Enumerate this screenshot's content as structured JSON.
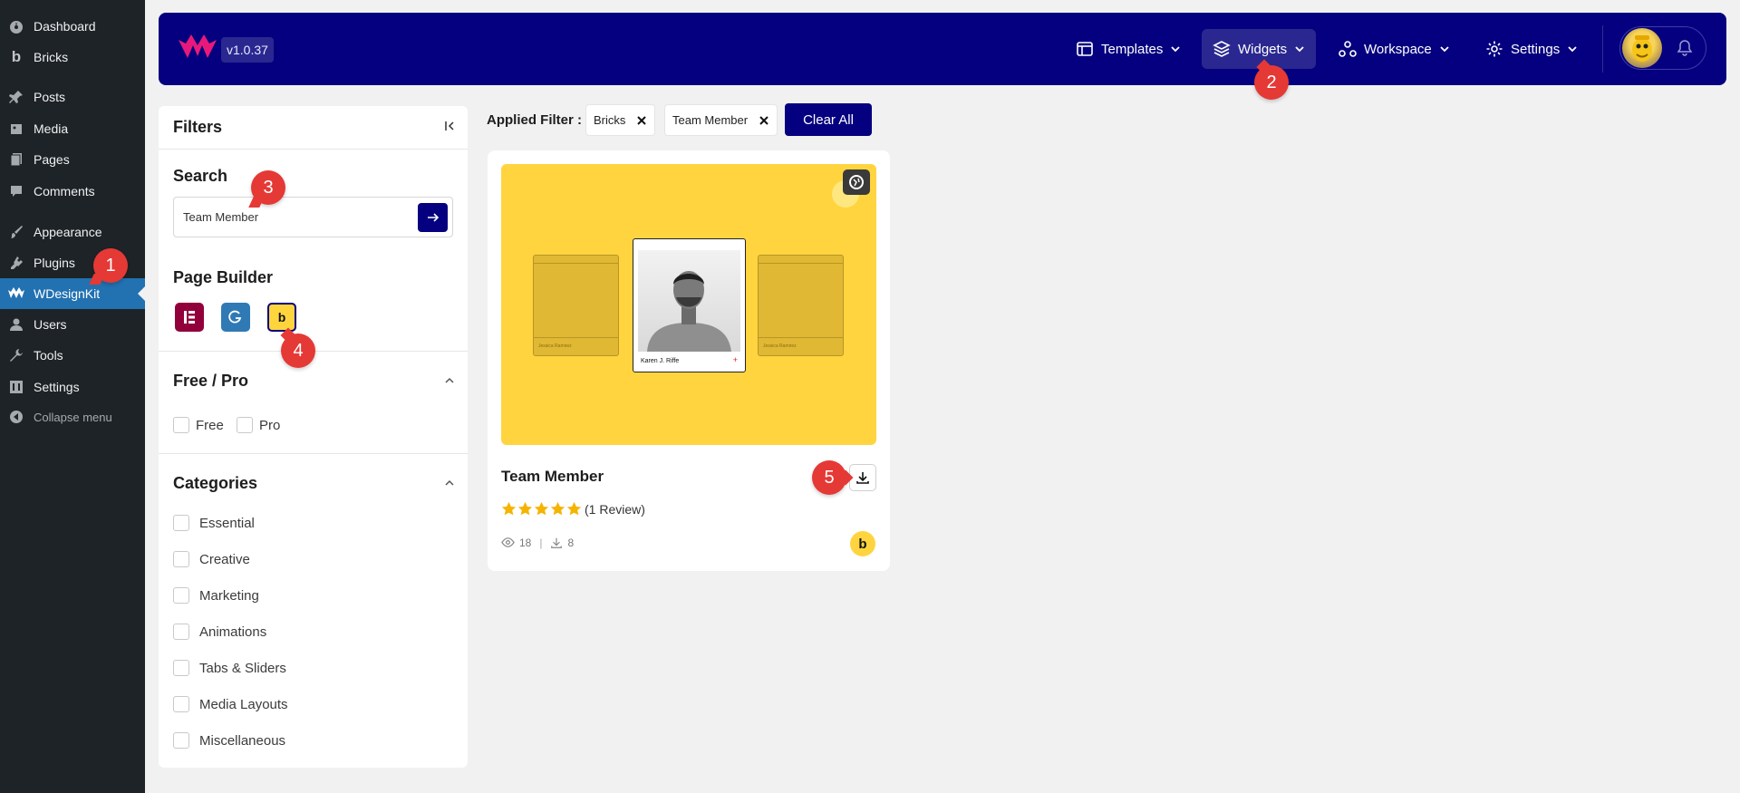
{
  "wp_menu": {
    "items": [
      {
        "label": "Dashboard",
        "icon": "dashboard-icon"
      },
      {
        "label": "Bricks",
        "icon": "bricks-icon"
      },
      {
        "label": "Posts",
        "icon": "pin-icon"
      },
      {
        "label": "Media",
        "icon": "media-icon"
      },
      {
        "label": "Pages",
        "icon": "pages-icon"
      },
      {
        "label": "Comments",
        "icon": "comment-icon"
      },
      {
        "label": "Appearance",
        "icon": "brush-icon"
      },
      {
        "label": "Plugins",
        "icon": "plugin-icon"
      },
      {
        "label": "WDesignKit",
        "icon": "wdesignkit-icon",
        "active": true
      },
      {
        "label": "Users",
        "icon": "user-icon"
      },
      {
        "label": "Tools",
        "icon": "wrench-icon"
      },
      {
        "label": "Settings",
        "icon": "settings-icon"
      }
    ],
    "collapse_label": "Collapse menu"
  },
  "header": {
    "version": "v1.0.37",
    "nav": {
      "templates": "Templates",
      "widgets": "Widgets",
      "workspace": "Workspace",
      "settings": "Settings"
    },
    "brand_color": "#05007f"
  },
  "filters": {
    "title": "Filters",
    "search": {
      "title": "Search",
      "value": "Team Member"
    },
    "page_builder": {
      "title": "Page Builder",
      "builders": [
        "Elementor",
        "Gutenberg",
        "Bricks"
      ],
      "selected": "Bricks",
      "bricks_glyph": "b"
    },
    "free_pro": {
      "title": "Free / Pro",
      "options": [
        "Free",
        "Pro"
      ]
    },
    "categories": {
      "title": "Categories",
      "options": [
        "Essential",
        "Creative",
        "Marketing",
        "Animations",
        "Tabs & Sliders",
        "Media Layouts",
        "Miscellaneous"
      ]
    }
  },
  "applied": {
    "label": "Applied Filter :",
    "chips": [
      "Bricks",
      "Team Member"
    ],
    "clear_label": "Clear All"
  },
  "card": {
    "title": "Team Member",
    "rating": 5,
    "review_text": "(1 Review)",
    "views": "18",
    "downloads": "8",
    "preview_name": "Karen J. Riffe",
    "preview_side_names": [
      "Jessica Ramirez",
      "Jessica Ramirez"
    ],
    "badge_glyph": "b"
  },
  "markers": [
    "1",
    "2",
    "3",
    "4",
    "5"
  ]
}
